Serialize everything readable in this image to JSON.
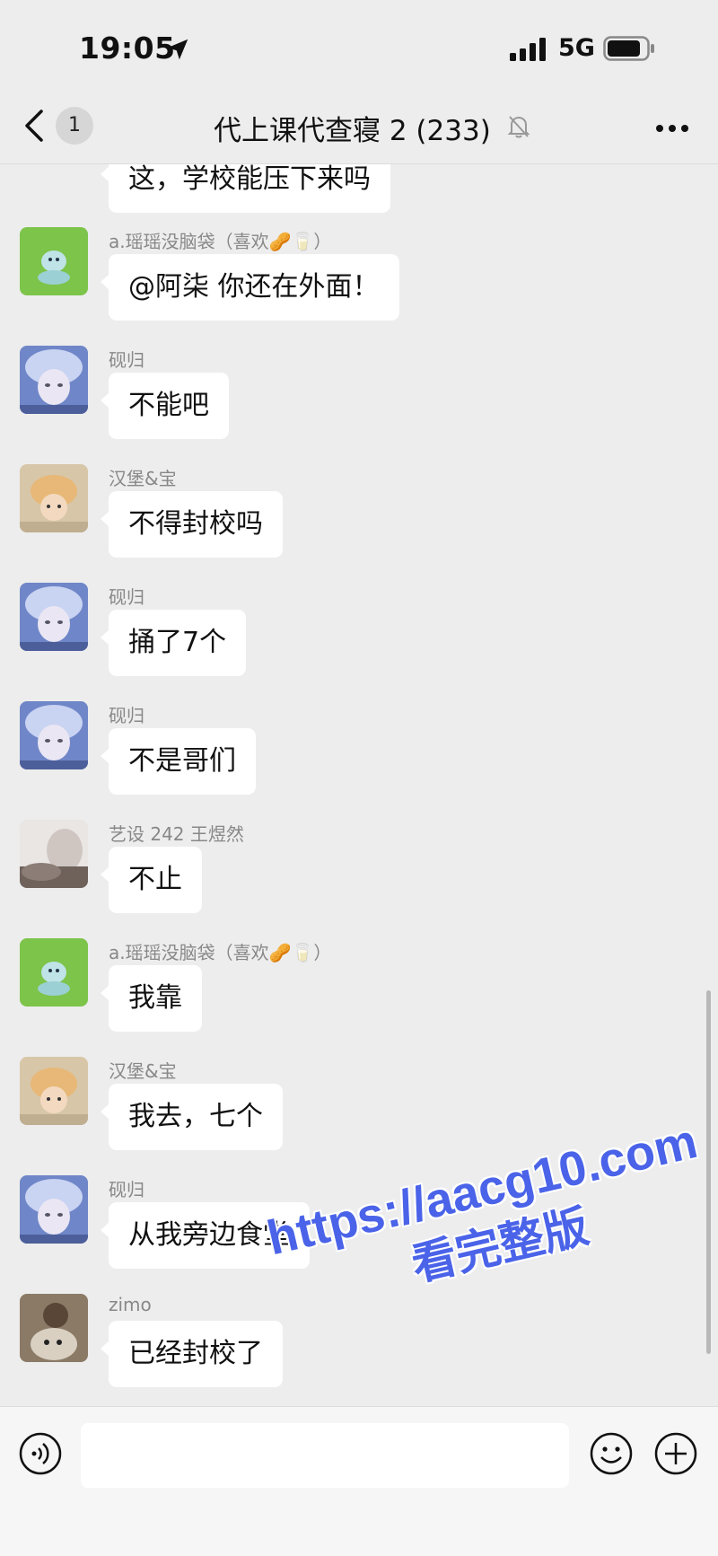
{
  "status": {
    "time": "19:05",
    "network": "5G"
  },
  "nav": {
    "unread": "1",
    "title": "代上课代查寝 2 (233)"
  },
  "messages": [
    {
      "sender": "",
      "text": "这，学校能压下来吗",
      "avatar": "avatar-child-photo",
      "partial": true
    },
    {
      "sender": "a.瑶瑶没脑袋（喜欢🥜🥛）",
      "text": "@阿柒 你还在外面！",
      "avatar": "avatar-green-cartoon"
    },
    {
      "sender": "砚归",
      "text": "不能吧",
      "avatar": "avatar-anime-blue"
    },
    {
      "sender": "汉堡&宝",
      "text": "不得封校吗",
      "avatar": "avatar-child-photo"
    },
    {
      "sender": "砚归",
      "text": "捅了7个",
      "avatar": "avatar-anime-blue"
    },
    {
      "sender": "砚归",
      "text": "不是哥们",
      "avatar": "avatar-anime-blue"
    },
    {
      "sender": "艺设 242 王煜然",
      "text": "不止",
      "avatar": "avatar-grey-photo"
    },
    {
      "sender": "a.瑶瑶没脑袋（喜欢🥜🥛）",
      "text": "我靠",
      "avatar": "avatar-green-cartoon"
    },
    {
      "sender": "汉堡&宝",
      "text": "我去，七个",
      "avatar": "avatar-child-photo"
    },
    {
      "sender": "砚归",
      "text": "从我旁边食堂",
      "avatar": "avatar-anime-blue"
    },
    {
      "sender": "zimo",
      "text": "已经封校了",
      "avatar": "avatar-dog-photo"
    }
  ],
  "watermark": {
    "line1": "https://aacg10.com",
    "line2": "看完整版"
  },
  "icons": {
    "location": "location-arrow-icon",
    "signal": "signal-icon",
    "battery": "battery-icon",
    "back": "chevron-left-icon",
    "mute": "bell-slash-icon",
    "more": "more-dots-icon",
    "voice": "voice-icon",
    "emoji": "emoji-icon",
    "plus": "plus-circle-icon"
  },
  "colors": {
    "background": "#ededed",
    "bubble": "#ffffff",
    "watermark": "#4a63e8"
  }
}
